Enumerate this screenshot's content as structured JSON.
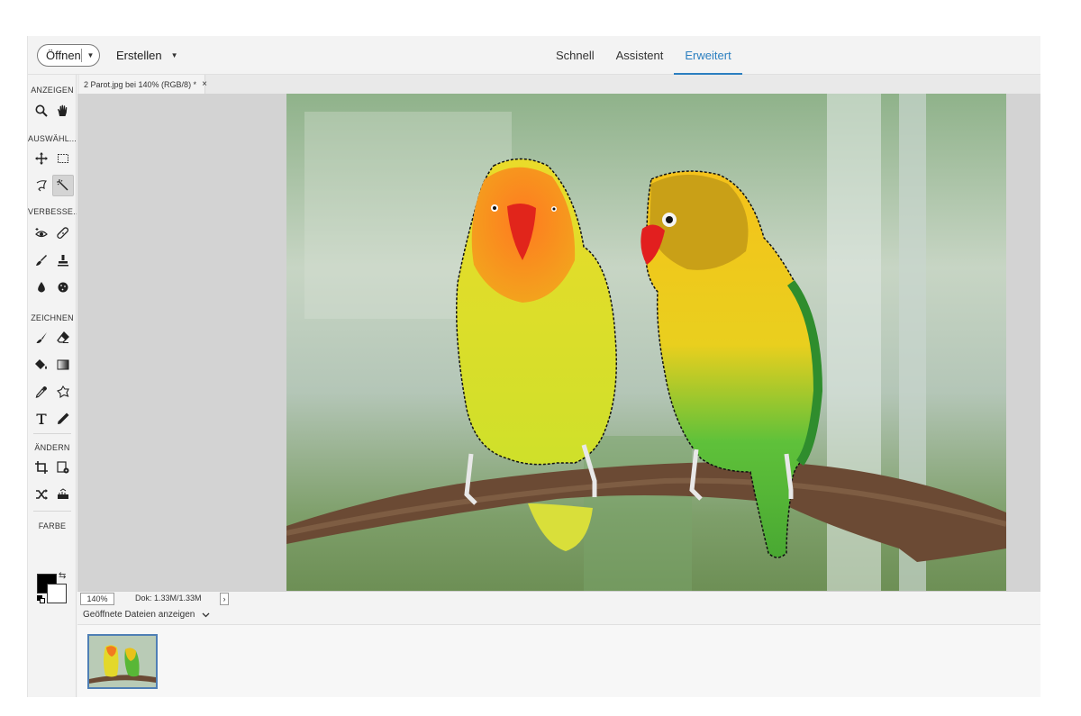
{
  "topbar": {
    "open_label": "Öffnen",
    "create_label": "Erstellen",
    "modes": [
      "Schnell",
      "Assistent",
      "Erweitert"
    ],
    "active_mode": "Erweitert"
  },
  "toolbox": {
    "sections": {
      "view": "ANZEIGEN",
      "select": "AUSWÄHL...",
      "enhance": "VERBESSE...",
      "draw": "ZEICHNEN",
      "modify": "ÄNDERN",
      "color": "FARBE"
    },
    "tools": [
      "zoom-tool",
      "hand-tool",
      "move-tool",
      "marquee-tool",
      "lasso-tool",
      "magic-wand-tool",
      "red-eye-tool",
      "spot-healing-tool",
      "smart-brush-tool",
      "clone-stamp-tool",
      "blur-tool",
      "sponge-tool",
      "brush-tool",
      "eraser-tool",
      "paint-bucket-tool",
      "gradient-tool",
      "eyedropper-tool",
      "custom-shape-tool",
      "type-tool",
      "pencil-tool",
      "crop-tool",
      "recompose-tool",
      "content-aware-move-tool",
      "straighten-tool"
    ],
    "selected_tool": "magic-wand-tool",
    "foreground_color": "#000000",
    "background_color": "#ffffff"
  },
  "document": {
    "tab_title": "2 Parot.jpg bei 140% (RGB/8) *",
    "close_glyph": "×"
  },
  "status": {
    "zoom": "140%",
    "doc_size": "Dok: 1.33M/1.33M",
    "arrow": "›"
  },
  "bin": {
    "label": "Geöffnete Dateien anzeigen"
  },
  "colors": {
    "accent": "#2b7fc0",
    "thumb_border": "#4f7fb5"
  }
}
